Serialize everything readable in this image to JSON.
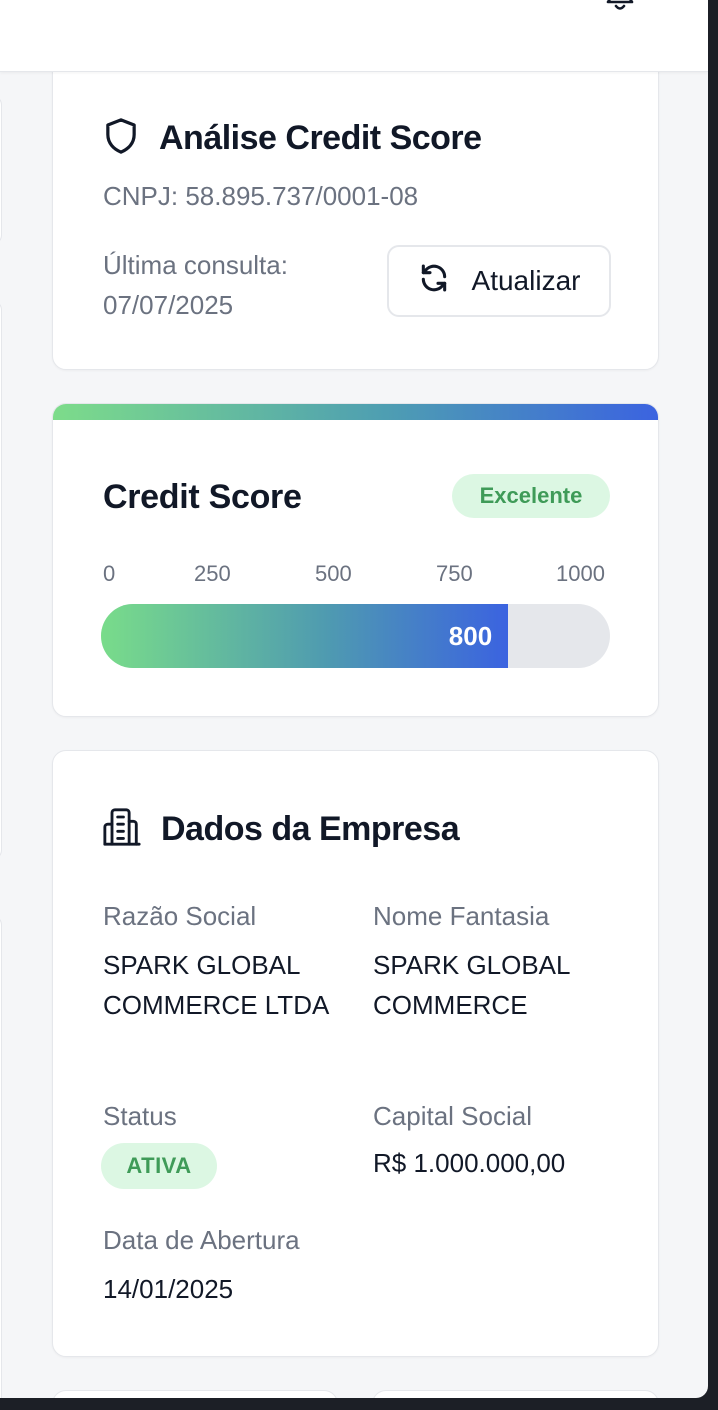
{
  "header": {
    "bell_icon": "bell-icon"
  },
  "credit_analysis": {
    "title": "Análise Credit Score",
    "icon": "shield-icon",
    "cnpj": "CNPJ: 58.895.737/0001-08",
    "last_query_label": "Última consulta:",
    "last_query_date": "07/07/2025",
    "refresh_label": "Atualizar",
    "refresh_icon": "refresh-icon"
  },
  "credit_score": {
    "title": "Credit Score",
    "rating": "Excelente",
    "ticks": [
      "0",
      "250",
      "500",
      "750",
      "1000"
    ],
    "value": 800,
    "value_label": "800",
    "min": 0,
    "max": 1000,
    "colors": {
      "start": "#79dc8a",
      "mid": "#4f9bb0",
      "end": "#3b63e0",
      "track": "#e5e7eb"
    }
  },
  "company": {
    "title": "Dados da Empresa",
    "icon": "building-icon",
    "razao_social_label": "Razão Social",
    "razao_social_value": "SPARK GLOBAL COMMERCE LTDA",
    "nome_fantasia_label": "Nome Fantasia",
    "nome_fantasia_value": "SPARK GLOBAL COMMERCE",
    "status_label": "Status",
    "status_value": "ATIVA",
    "capital_label": "Capital Social",
    "capital_value": "R$ 1.000.000,00",
    "abertura_label": "Data de Abertura",
    "abertura_value": "14/01/2025"
  }
}
